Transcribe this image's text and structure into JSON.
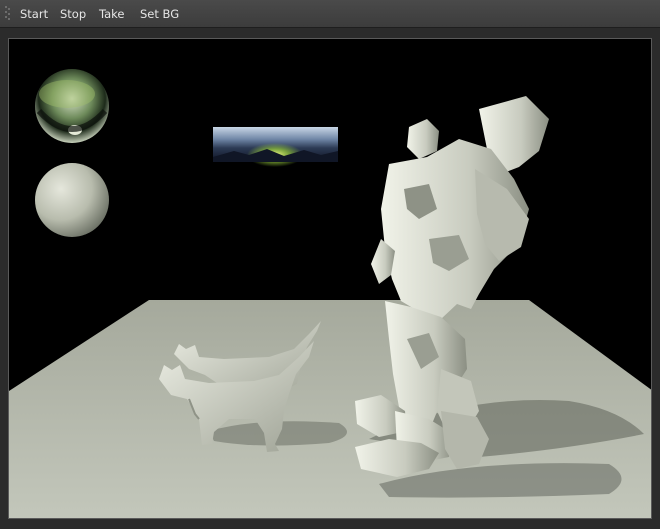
{
  "toolbar": {
    "start_label": "Start",
    "stop_label": "Stop",
    "take_label": "Take",
    "set_bg_label": "Set BG"
  },
  "viewport": {
    "background_color": "#000000",
    "floor_color": "#b9bdb1",
    "model_color": "#d6d8cc",
    "objects": [
      "chrome-sphere",
      "diffuse-sphere",
      "environment-map-preview",
      "floor-plane",
      "cat-model",
      "cat-model",
      "robot-model"
    ]
  }
}
